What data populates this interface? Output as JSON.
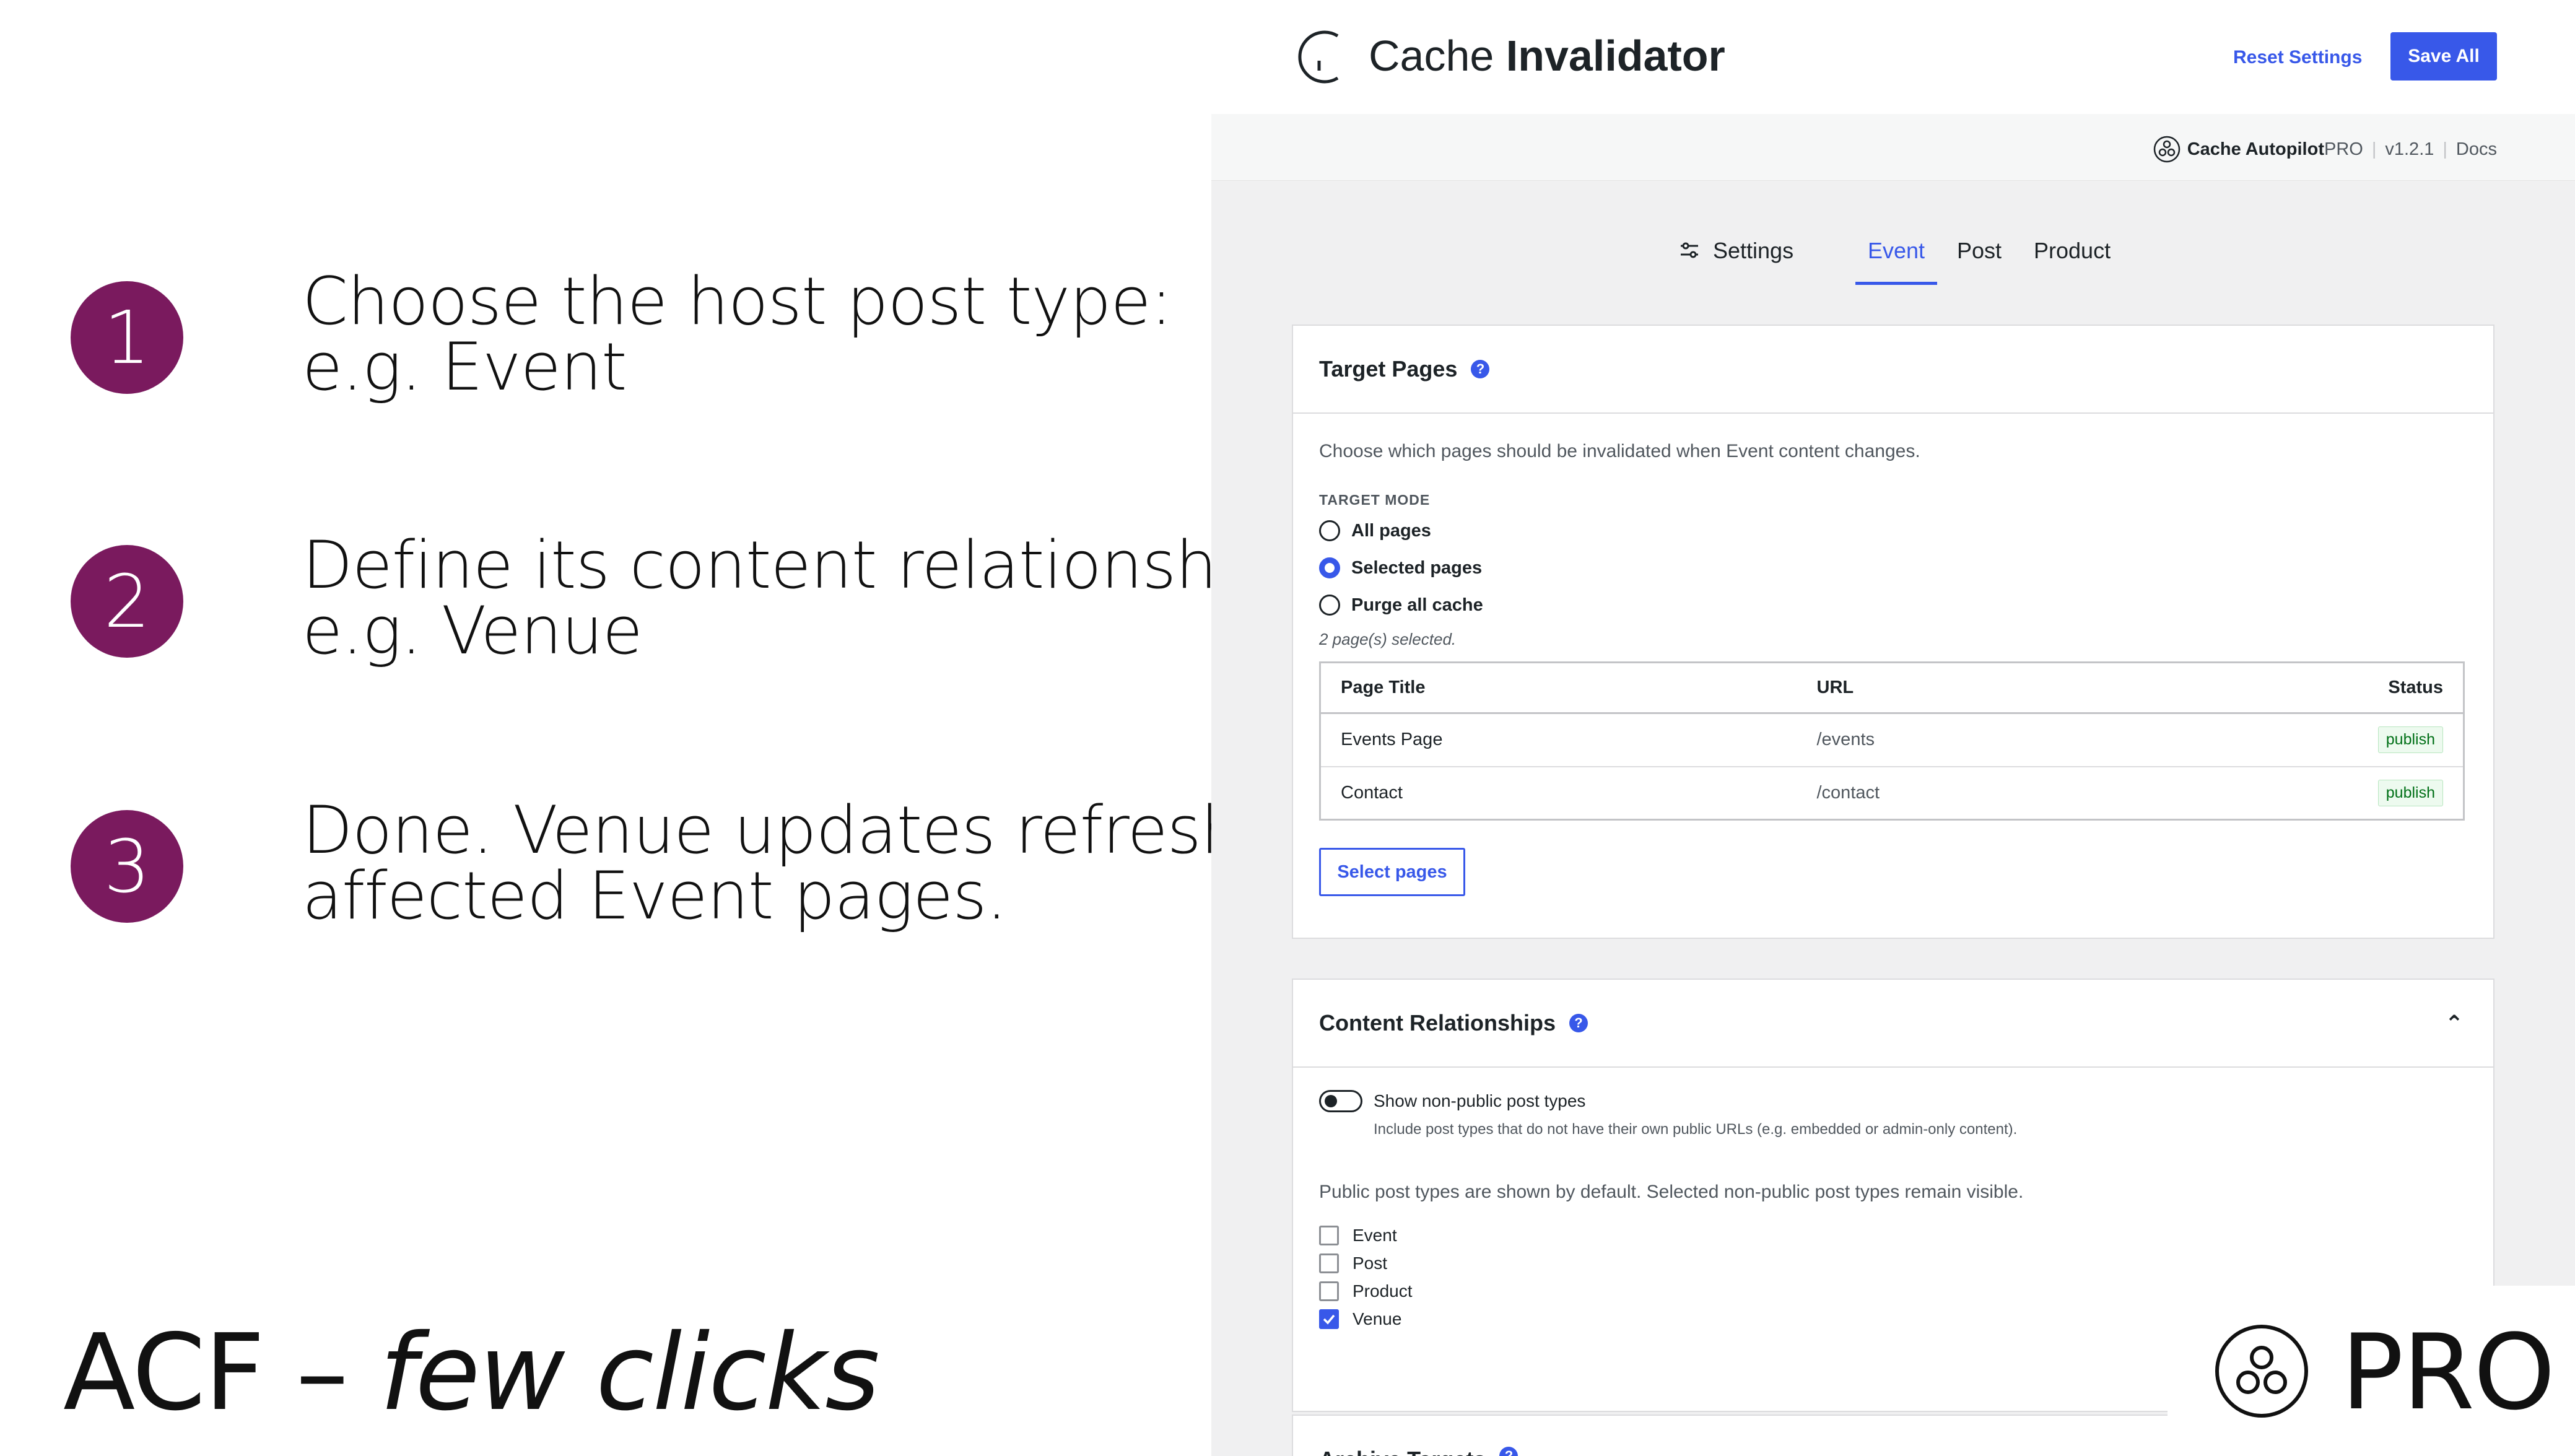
{
  "slide": {
    "steps": [
      {
        "number": "1",
        "line1": "Choose the host post type:",
        "line2": "e.g. Event"
      },
      {
        "number": "2",
        "line1": "Define its content relationships:",
        "line2": "e.g. Venue"
      },
      {
        "number": "3",
        "line1": "Done. Venue updates refresh",
        "line2": "affected Event pages."
      }
    ],
    "tagline_prefix": "ACF – ",
    "tagline_italic": "few clicks",
    "pro_label": "PRO"
  },
  "header": {
    "title_light": "Cache ",
    "title_bold": "Invalidator",
    "reset_label": "Reset Settings",
    "save_label": "Save All"
  },
  "subbar": {
    "brand": "Cache Autopilot",
    "edition": " PRO",
    "version": "v1.2.1",
    "docs": "Docs"
  },
  "tabs": {
    "settings": "Settings",
    "event": "Event",
    "post": "Post",
    "product": "Product",
    "active": "Event"
  },
  "target_pages": {
    "title": "Target Pages",
    "description": "Choose which pages should be invalidated when Event content changes.",
    "mode_label": "TARGET MODE",
    "modes": [
      "All pages",
      "Selected pages",
      "Purge all cache"
    ],
    "selected_mode": "Selected pages",
    "selected_count": "2 page(s) selected.",
    "table": {
      "headers": [
        "Page Title",
        "URL",
        "Status"
      ],
      "rows": [
        {
          "title": "Events Page",
          "url": "/events",
          "status": "publish"
        },
        {
          "title": "Contact",
          "url": "/contact",
          "status": "publish"
        }
      ]
    },
    "select_button": "Select pages"
  },
  "content_relationships": {
    "title": "Content Relationships",
    "toggle_label": "Show non-public post types",
    "toggle_on": false,
    "toggle_help": "Include post types that do not have their own public URLs (e.g. embedded or admin-only content).",
    "info": "Public post types are shown by default. Selected non-public post types remain visible.",
    "post_types": [
      {
        "label": "Event",
        "checked": false
      },
      {
        "label": "Post",
        "checked": false
      },
      {
        "label": "Product",
        "checked": false
      },
      {
        "label": "Venue",
        "checked": true
      }
    ]
  },
  "next_section": {
    "title": "Archive Targets"
  },
  "colors": {
    "accent": "#3858e9",
    "step_circle": "#7a1a5e",
    "app_bg": "#f0f0f1"
  }
}
